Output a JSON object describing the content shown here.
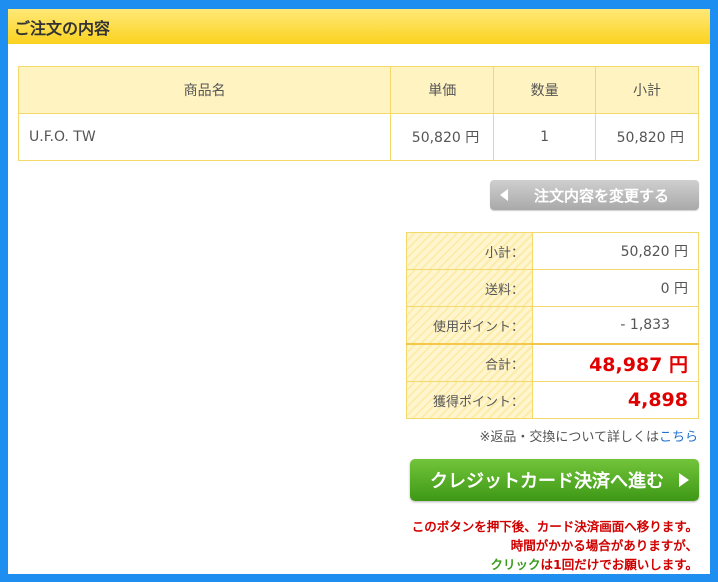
{
  "header": {
    "title": "ご注文の内容"
  },
  "order_table": {
    "columns": [
      "商品名",
      "単価",
      "数量",
      "小計"
    ],
    "rows": [
      {
        "name": "U.F.O. TW",
        "price": "50,820 円",
        "qty": "1",
        "subtotal": "50,820 円"
      }
    ]
  },
  "change_button": {
    "label": "注文内容を変更する"
  },
  "summary": {
    "subtotal_label": "小計：",
    "subtotal_value": "50,820 円",
    "shipping_label": "送料：",
    "shipping_value": "0 円",
    "points_used_label": "使用ポイント：",
    "points_used_value": "- 1,833",
    "total_label": "合計：",
    "total_value": "48,987 円",
    "points_earned_label": "獲得ポイント：",
    "points_earned_value": "4,898"
  },
  "returns_note": {
    "text": "※返品・交換について詳しくは",
    "link": "こちら"
  },
  "proceed_button": {
    "label": "クレジットカード決済へ進む"
  },
  "warning": {
    "line1": "このボタンを押下後、カード決済画面へ移ります。",
    "line2": "時間がかかる場合がありますが、",
    "line3_green": "クリック",
    "line3_rest": "は1回だけでお願いします。"
  },
  "colors": {
    "frame": "#1e8ff0",
    "header": "#fbd21e",
    "accent_red": "#e00000",
    "button_green": "#3e9816"
  }
}
